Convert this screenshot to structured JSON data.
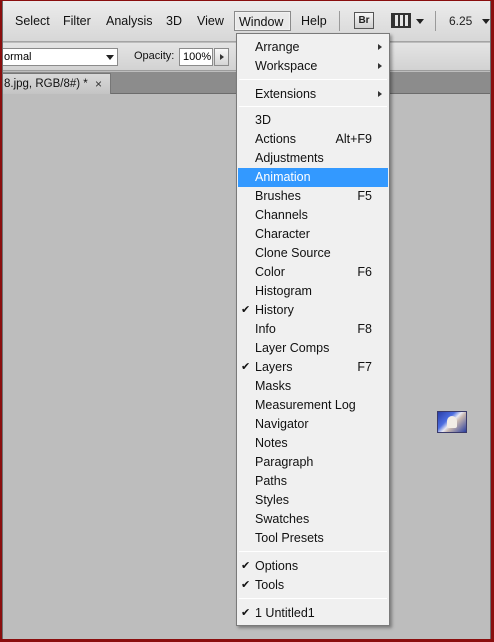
{
  "menubar": {
    "items": [
      "Select",
      "Filter",
      "Analysis",
      "3D",
      "View",
      "Window",
      "Help"
    ],
    "bridge_label": "Br",
    "zoom": "6.25"
  },
  "options": {
    "blend_mode": "ormal",
    "opacity_label": "Opacity:",
    "opacity_value": "100%"
  },
  "document": {
    "tab_title": "8.jpg, RGB/8#) *",
    "close_glyph": "×"
  },
  "window_menu": {
    "items": [
      {
        "label": "Arrange",
        "submenu": true
      },
      {
        "label": "Workspace",
        "submenu": true
      },
      {
        "label": "Extensions",
        "submenu": true
      },
      {
        "label": "3D"
      },
      {
        "label": "Actions",
        "shortcut": "Alt+F9"
      },
      {
        "label": "Adjustments"
      },
      {
        "label": "Animation",
        "highlighted": true
      },
      {
        "label": "Brushes",
        "shortcut": "F5"
      },
      {
        "label": "Channels"
      },
      {
        "label": "Character"
      },
      {
        "label": "Clone Source"
      },
      {
        "label": "Color",
        "shortcut": "F6"
      },
      {
        "label": "Histogram"
      },
      {
        "label": "History",
        "checked": true
      },
      {
        "label": "Info",
        "shortcut": "F8"
      },
      {
        "label": "Layer Comps"
      },
      {
        "label": "Layers",
        "shortcut": "F7",
        "checked": true
      },
      {
        "label": "Masks"
      },
      {
        "label": "Measurement Log"
      },
      {
        "label": "Navigator"
      },
      {
        "label": "Notes"
      },
      {
        "label": "Paragraph"
      },
      {
        "label": "Paths"
      },
      {
        "label": "Styles"
      },
      {
        "label": "Swatches"
      },
      {
        "label": "Tool Presets"
      },
      {
        "label": "Options",
        "checked": true
      },
      {
        "label": "Tools",
        "checked": true
      },
      {
        "label": "1 Untitled1",
        "checked": true
      }
    ]
  },
  "colors": {
    "highlight": "#3399ff",
    "frame": "#8a0e0e",
    "workspace": "#bdbdbd"
  }
}
